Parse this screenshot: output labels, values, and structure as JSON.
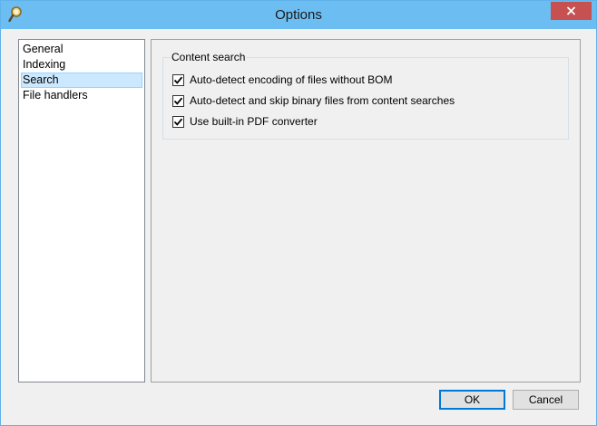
{
  "window": {
    "title": "Options"
  },
  "nav": {
    "items": [
      {
        "label": "General",
        "selected": false
      },
      {
        "label": "Indexing",
        "selected": false
      },
      {
        "label": "Search",
        "selected": true
      },
      {
        "label": "File handlers",
        "selected": false
      }
    ]
  },
  "content_search": {
    "title": "Content search",
    "options": [
      {
        "label": "Auto-detect encoding of files without BOM",
        "checked": true
      },
      {
        "label": "Auto-detect and skip binary files from content searches",
        "checked": true
      },
      {
        "label": "Use built-in PDF converter",
        "checked": true
      }
    ]
  },
  "buttons": {
    "ok": "OK",
    "cancel": "Cancel"
  },
  "icons": {
    "app": "magnifier-icon",
    "close": "close-icon",
    "check": "checkmark-icon"
  },
  "colors": {
    "titlebar": "#6cbdf1",
    "close_button": "#c75050",
    "selection": "#cce8ff",
    "default_button_border": "#0078d7"
  }
}
